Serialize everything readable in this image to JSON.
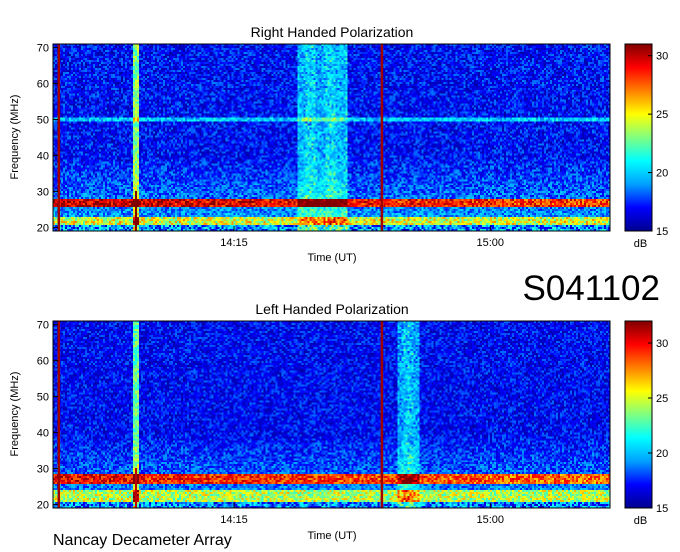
{
  "observation_id": "S041102",
  "instrument": "Nancay Decameter Array",
  "colors": {
    "colormap": [
      "#00008f",
      "#0000ff",
      "#00a0ff",
      "#00ffff",
      "#80ff80",
      "#ffff00",
      "#ff8000",
      "#ff0000",
      "#800000"
    ]
  },
  "chart_data": [
    {
      "type": "heatmap",
      "title": "Right Handed Polarization",
      "xlabel": "Time (UT)",
      "ylabel": "Frequency (MHz)",
      "xticks": [
        "14:15",
        "15:00"
      ],
      "yticks": [
        20,
        30,
        40,
        50,
        60,
        70
      ],
      "ylim": [
        19,
        71
      ],
      "colorbar": {
        "label": "dB",
        "ticks": [
          15,
          20,
          25,
          30
        ],
        "range": [
          15,
          31
        ]
      },
      "features": {
        "background_db": 17,
        "bright_band_mhz": [
          25.5,
          28
        ],
        "low_band_mhz": [
          20.5,
          23
        ],
        "vertical_lines_relative_time": [
          0.01,
          0.15,
          0.59
        ],
        "burst_group_relative_time": [
          0.44,
          0.53
        ],
        "horizontal_line_mhz": 50
      }
    },
    {
      "type": "heatmap",
      "title": "Left Handed Polarization",
      "xlabel": "Time (UT)",
      "ylabel": "Frequency (MHz)",
      "xticks": [
        "14:15",
        "15:00"
      ],
      "yticks": [
        20,
        30,
        40,
        50,
        60,
        70
      ],
      "ylim": [
        19,
        71
      ],
      "colorbar": {
        "label": "dB",
        "ticks": [
          15,
          20,
          25,
          30
        ],
        "range": [
          15,
          32
        ]
      },
      "features": {
        "background_db": 17,
        "bright_band_mhz": [
          25.5,
          28.5
        ],
        "low_band_mhz": [
          20.5,
          24
        ],
        "vertical_lines_relative_time": [
          0.01,
          0.15,
          0.59
        ],
        "burst_group_relative_time": [
          0.62,
          0.66
        ],
        "horizontal_line_mhz": null
      }
    }
  ]
}
